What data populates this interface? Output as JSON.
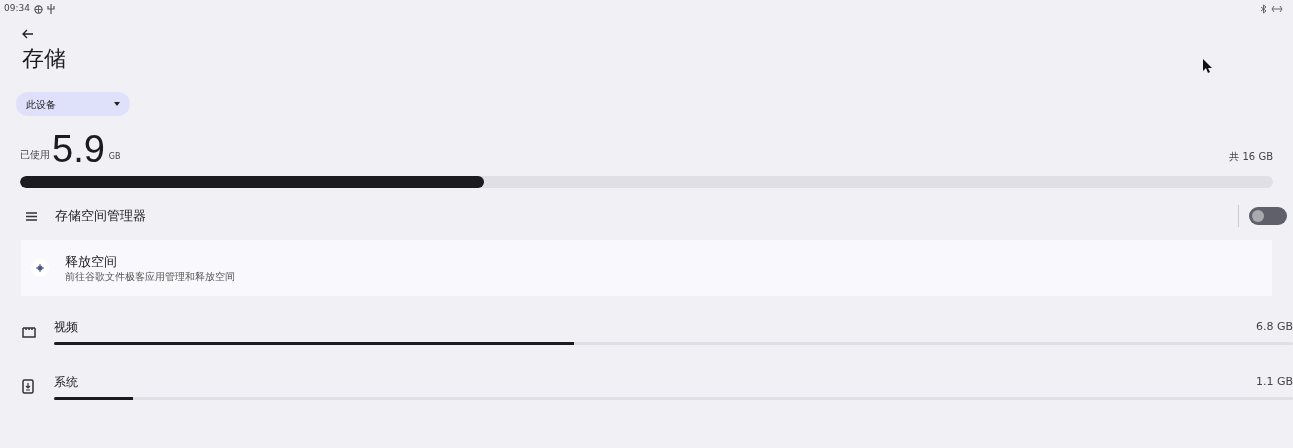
{
  "status_bar": {
    "time": "09:34"
  },
  "title": "存储",
  "device_selector": {
    "value": "此设备"
  },
  "usage": {
    "used_label": "已使用",
    "used_value": "5.9",
    "used_unit": "GB",
    "total": "共 16 GB",
    "level": 0.37
  },
  "storage_manager": {
    "label": "存储空间管理器",
    "on": false
  },
  "free_space": {
    "title": "释放空间",
    "subtitle": "前往谷歌文件极客应用管理和释放空间"
  },
  "categories": [
    {
      "kind": "video",
      "label": "视频",
      "size": "6.8 GB",
      "level": 0.42
    },
    {
      "kind": "system",
      "label": "系统",
      "size": "1.1 GB",
      "level": 0.064
    }
  ]
}
